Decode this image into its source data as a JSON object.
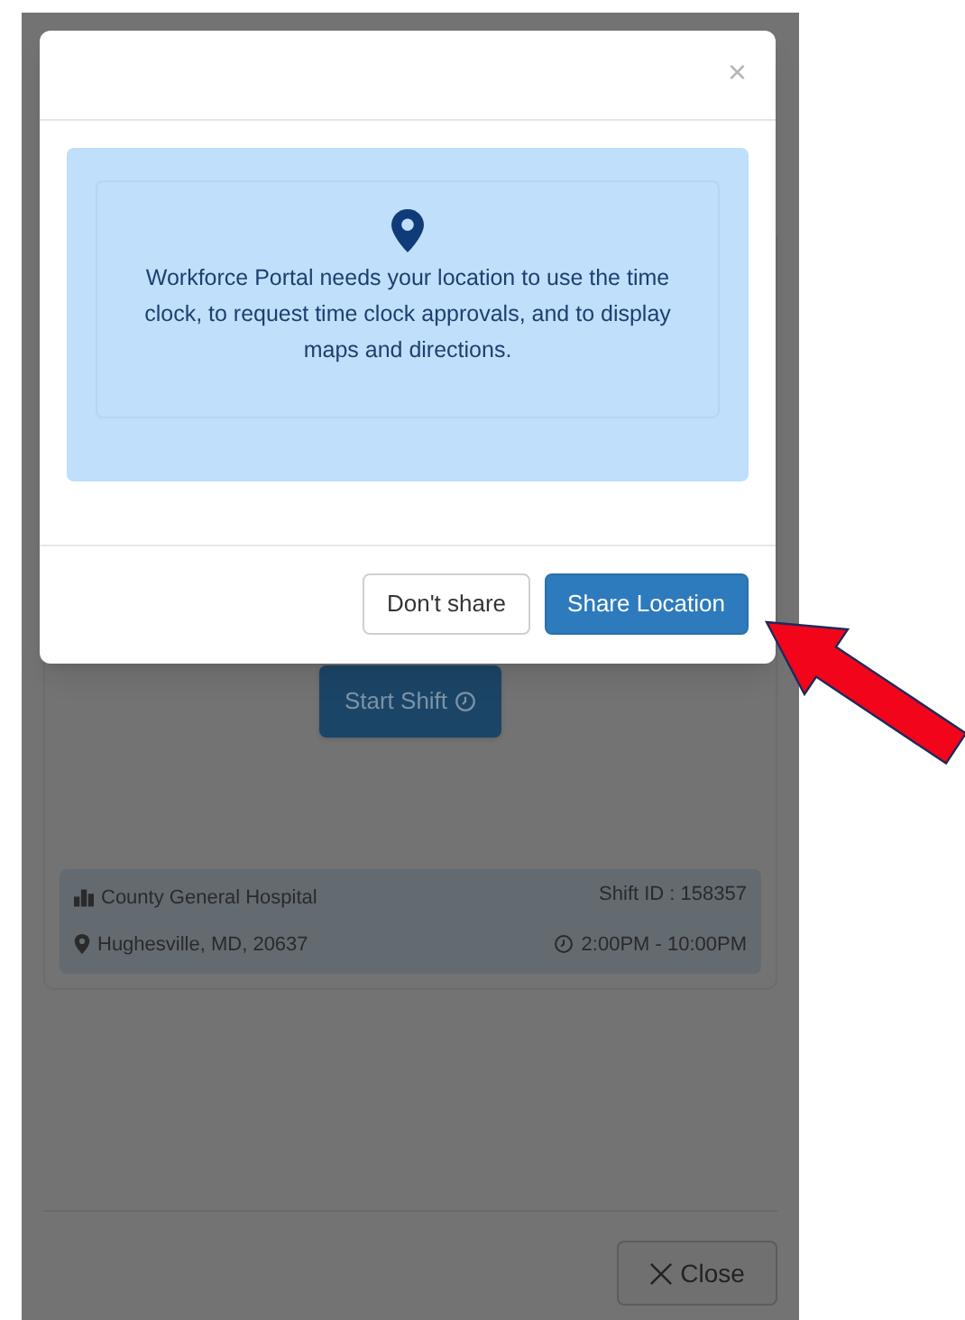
{
  "modal": {
    "close_symbol": "×",
    "message": "Workforce Portal needs your location to use the time clock, to request time clock approvals, and to display maps and directions.",
    "buttons": [
      {
        "label": "Don't share",
        "kind": "secondary"
      },
      {
        "label": "Share Location",
        "kind": "primary"
      }
    ]
  },
  "background": {
    "start_button": "Start Shift",
    "facility": "County General Hospital",
    "shift_id": "Shift ID : 158357",
    "address": "Hughesville, MD, 20637",
    "time": "2:00PM - 10:00PM",
    "close_button": "Close"
  }
}
